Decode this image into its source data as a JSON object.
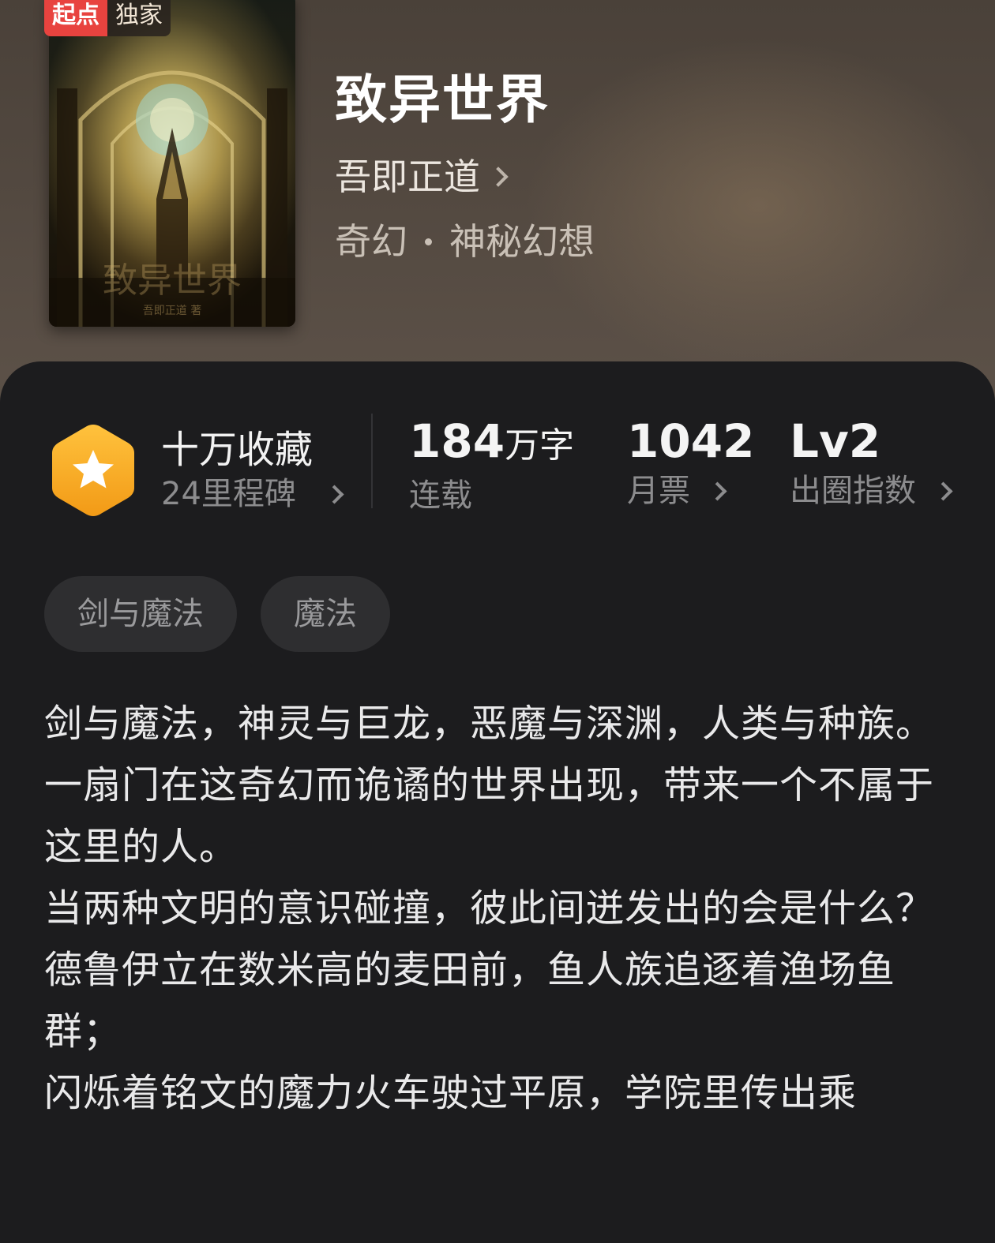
{
  "badge": {
    "brand": "起点",
    "label": "独家"
  },
  "book": {
    "title": "致异世界",
    "author": "吾即正道",
    "category": "奇幻",
    "subcategory": "神秘幻想"
  },
  "stats": {
    "milestone_title": "十万收藏",
    "milestone_sub": "24里程碑",
    "words_value": "184",
    "words_unit": "万字",
    "words_label": "连载",
    "tickets_value": "1042",
    "tickets_label": "月票",
    "level_value": "Lv2",
    "level_label": "出圈指数"
  },
  "tags": [
    "剑与魔法",
    "魔法"
  ],
  "synopsis": [
    "剑与魔法，神灵与巨龙，恶魔与深渊，人类与种族。",
    "一扇门在这奇幻而诡谲的世界出现，带来一个不属于这里的人。",
    "当两种文明的意识碰撞，彼此间迸发出的会是什么？",
    "德鲁伊立在数米高的麦田前，鱼人族追逐着渔场鱼群；",
    "闪烁着铭文的魔力火车驶过平原，学院里传出乘"
  ],
  "colors": {
    "brand_red": "#e8433f",
    "milestone_orange": "#f6a623",
    "panel_bg": "#1c1c1e",
    "tag_bg": "#2e2e30"
  },
  "icons": {
    "milestone": "star-hexagon-icon",
    "chevron": "chevron-right-icon"
  }
}
